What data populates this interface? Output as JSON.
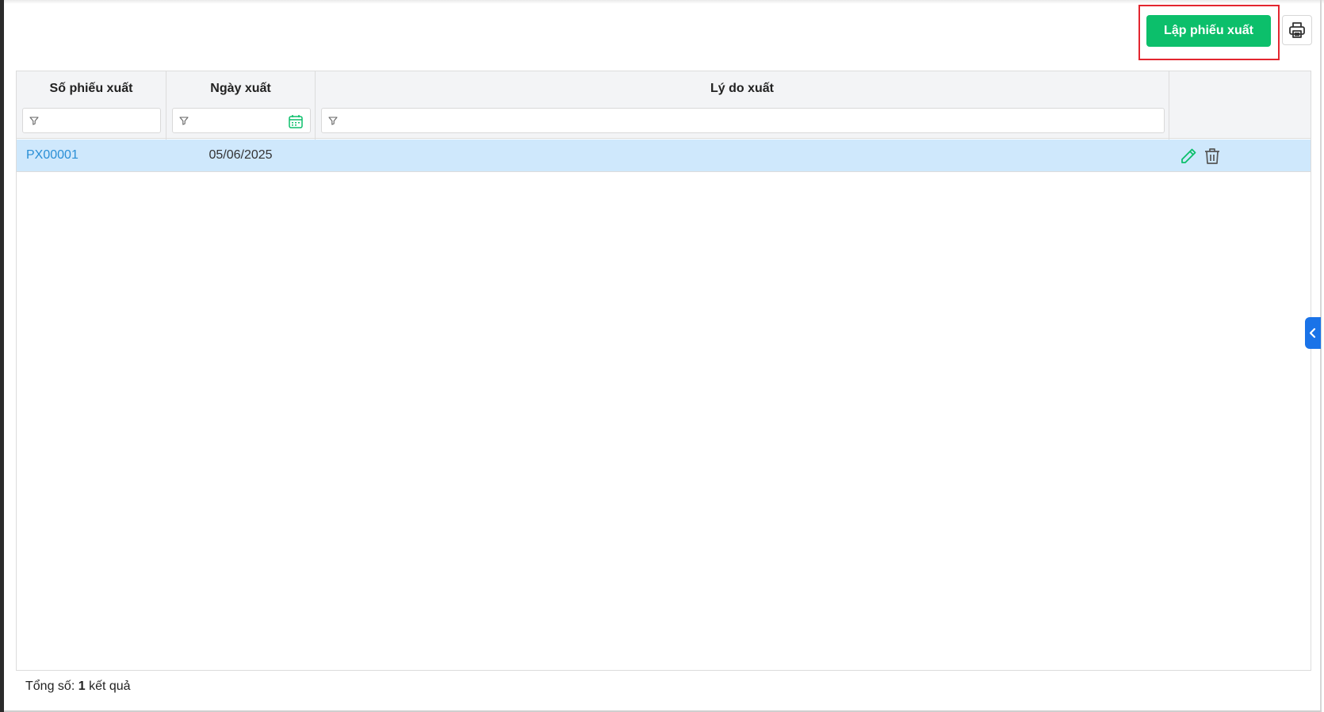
{
  "toolbar": {
    "create_label": "Lập phiếu xuất",
    "create_color": "#0cbf6b",
    "highlight_color": "#e3262f",
    "print_icon": "printer-icon"
  },
  "table": {
    "columns": [
      {
        "label": "Số phiếu xuất"
      },
      {
        "label": "Ngày xuất"
      },
      {
        "label": "Lý do xuất"
      },
      {
        "label": ""
      }
    ],
    "filters": {
      "code": "",
      "date": "",
      "reason": ""
    },
    "rows": [
      {
        "code": "PX00001",
        "date": "05/06/2025",
        "reason": ""
      }
    ],
    "row_highlight_color": "#cfe8fc",
    "link_color": "#2a8fd6"
  },
  "footer": {
    "prefix": "Tổng số:",
    "count": "1",
    "suffix": "kết quả"
  },
  "side_tab": {
    "icon": "chevron-left-icon",
    "color": "#1a73e8"
  }
}
